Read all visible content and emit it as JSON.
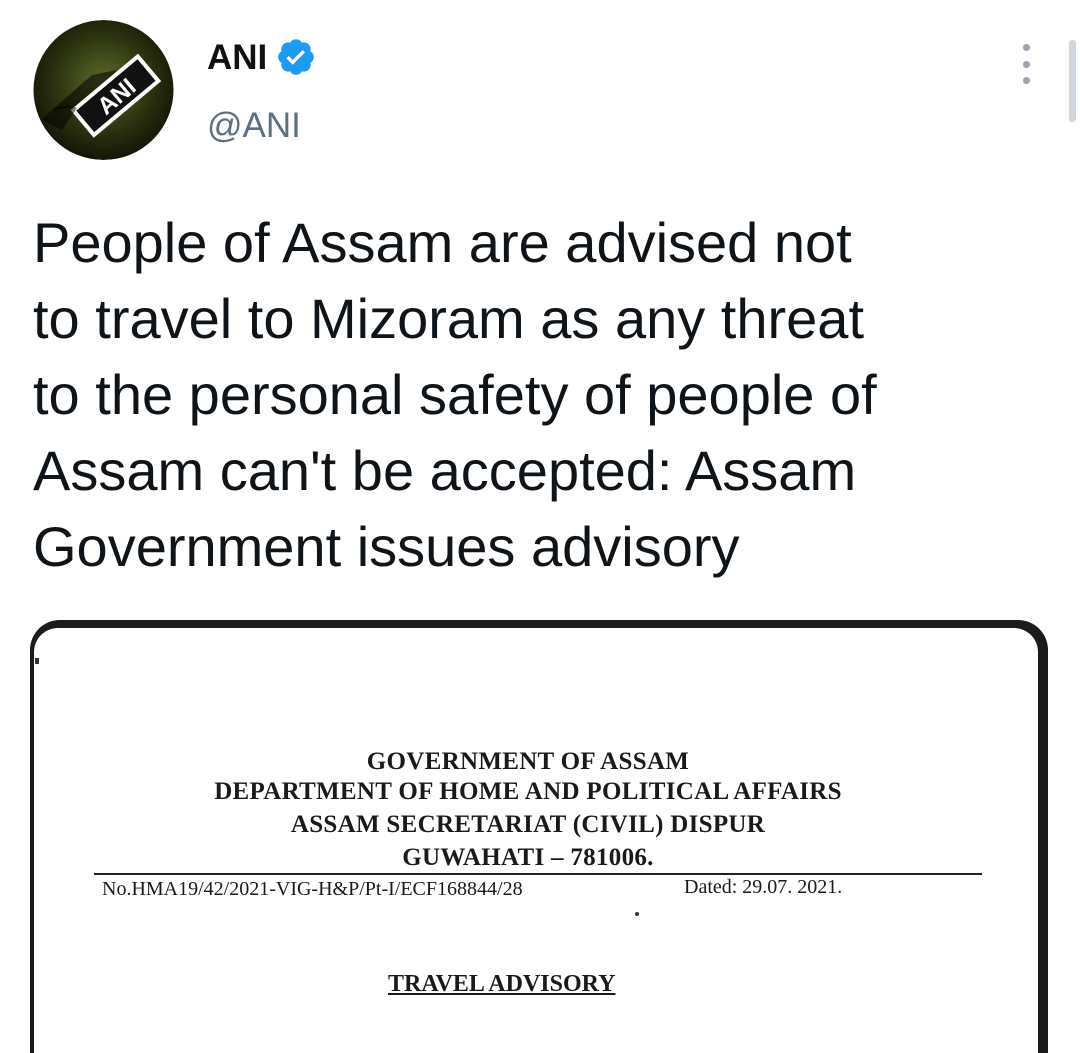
{
  "account": {
    "display_name": "ANI",
    "handle": "@ANI",
    "avatar_text": "ANI",
    "verified_icon": "verified-badge-icon",
    "menu_icon": "more-vertical-icon"
  },
  "tweet": {
    "text": "People of Assam are advised not\nto travel to Mizoram as any threat\nto the personal safety of people of\nAssam can't be accepted: Assam\nGovernment issues advisory"
  },
  "document": {
    "heading_1": "GOVERNMENT OF ASSAM",
    "heading_2": "DEPARTMENT OF HOME AND POLITICAL AFFAIRS",
    "heading_3": "ASSAM SECRETARIAT (CIVIL) DISPUR",
    "heading_4": "GUWAHATI – 781006.",
    "reference_no": "No.HMA19/42/2021-VIG-H&P/Pt-I/ECF168844/28",
    "dated": "Dated: 29.07. 2021.",
    "title": "TRAVEL ADVISORY"
  },
  "colors": {
    "verified_blue": "#1d9bf0",
    "handle_grey": "#5b7083",
    "text": "#0f1419",
    "menu_dots": "#9aa5b1"
  }
}
